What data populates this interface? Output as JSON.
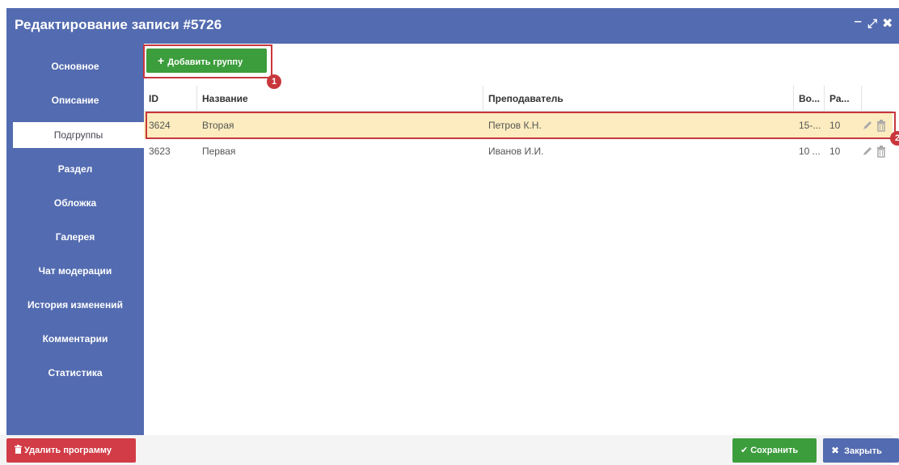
{
  "window": {
    "title": "Редактирование записи #5726",
    "controls": {
      "minimize": "‒",
      "maximize": "⤢",
      "close": "✖"
    }
  },
  "sidebar": {
    "items": [
      {
        "label": "Основное"
      },
      {
        "label": "Описание"
      },
      {
        "label": "Подгруппы",
        "active": true
      },
      {
        "label": "Раздел"
      },
      {
        "label": "Обложка"
      },
      {
        "label": "Галерея"
      },
      {
        "label": "Чат модерации"
      },
      {
        "label": "История изменений"
      },
      {
        "label": "Комментарии"
      },
      {
        "label": "Статистика"
      }
    ]
  },
  "toolbar": {
    "add_group_label": "Добавить группу",
    "add_group_icon": "+"
  },
  "annotations": {
    "badge1": "1",
    "badge2": "2"
  },
  "table": {
    "columns": [
      "ID",
      "Название",
      "Преподаватель",
      "Во...",
      "Ра..."
    ],
    "rows": [
      {
        "id": "3624",
        "name": "Вторая",
        "teacher": "Петров К.Н.",
        "age": "15-...",
        "places": "10",
        "selected": true
      },
      {
        "id": "3623",
        "name": "Первая",
        "teacher": "Иванов И.И.",
        "age": "10 ...",
        "places": "10",
        "selected": false
      }
    ]
  },
  "footer": {
    "delete_label": "Удалить программу",
    "save_label": "Сохранить",
    "close_label": "Закрыть"
  },
  "colors": {
    "primary": "#536bb0",
    "success": "#3c9d3c",
    "danger": "#d23c46",
    "highlight": "#c8373c",
    "selected_row": "#fcecbf"
  }
}
